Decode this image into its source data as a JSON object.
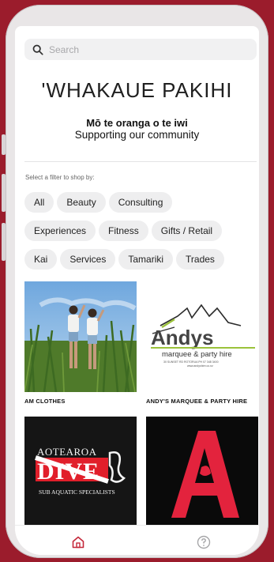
{
  "search": {
    "placeholder": "Search"
  },
  "header": {
    "title": "'WHAKAUE PAKIHI",
    "subtitle_maori": "Mō te oranga o te iwi",
    "subtitle_english": "Supporting our community"
  },
  "filters": {
    "label": "Select a filter to shop by:",
    "rows": [
      [
        "All",
        "Beauty",
        "Consulting"
      ],
      [
        "Experiences",
        "Fitness",
        "Gifts / Retail"
      ],
      [
        "Kai",
        "Services",
        "Tamariki",
        "Trades"
      ]
    ]
  },
  "businesses": [
    {
      "name": "AM CLOTHES"
    },
    {
      "name": "ANDY'S MARQUEE & PARTY HIRE",
      "logo": {
        "word": "Andys",
        "tagline": "marquee & party hire",
        "address": "30 SUNSET RD ROTORUA PH 07 348 3400",
        "web": "www.andyshire.co.nz"
      }
    },
    {
      "name": "",
      "logo": {
        "line1": "AOTEAROA",
        "line2": "DIVE",
        "line3": "SUB AQUATIC SPECIALISTS"
      }
    },
    {
      "name": "",
      "logo": {
        "letter": "A"
      }
    }
  ],
  "nav": {
    "home_icon": "home-icon",
    "help_icon": "help-circle-icon"
  },
  "colors": {
    "brand_red": "#9b1c2c",
    "accent_red": "#d9243b",
    "chip_bg": "#eeeeef"
  }
}
